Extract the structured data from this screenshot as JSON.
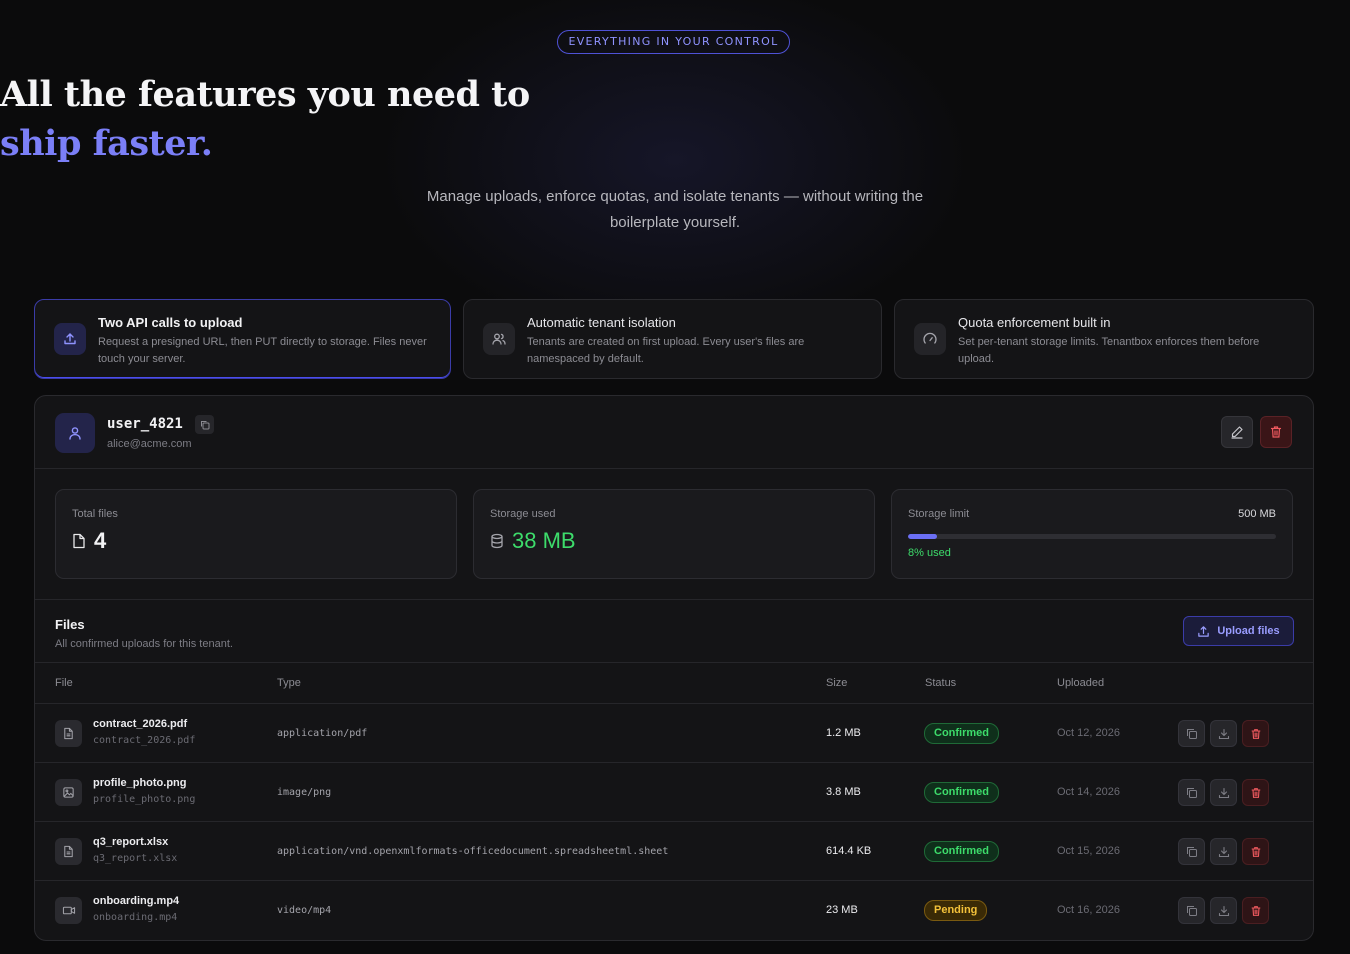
{
  "hero": {
    "eyebrow": "EVERYTHING IN YOUR CONTROL",
    "title_line1": "All the features you need to",
    "title_line2": "ship faster.",
    "subtitle": "Manage uploads, enforce quotas, and isolate tenants — without writing the boilerplate yourself."
  },
  "features": [
    {
      "title": "Two API calls to upload",
      "desc": "Request a presigned URL, then PUT directly to storage. Files never touch your server.",
      "icon": "upload-icon"
    },
    {
      "title": "Automatic tenant isolation",
      "desc": "Tenants are created on first upload. Every user's files are namespaced by default.",
      "icon": "users-icon"
    },
    {
      "title": "Quota enforcement built in",
      "desc": "Set per-tenant storage limits. Tenantbox enforces them before upload.",
      "icon": "gauge-icon"
    }
  ],
  "user": {
    "username": "user_4821",
    "email": "alice@acme.com"
  },
  "stats": {
    "total_files_label": "Total files",
    "total_files_value": "4",
    "storage_used_label": "Storage used",
    "storage_used_value": "38 MB",
    "storage_limit_label": "Storage limit",
    "storage_limit_value": "500 MB",
    "used_fraction": 0.08,
    "used_text": "8% used"
  },
  "files": {
    "title": "Files",
    "subtitle": "All confirmed uploads for this tenant.",
    "upload_label": "Upload files",
    "columns": {
      "file": "File",
      "type": "Type",
      "size": "Size",
      "status": "Status",
      "uploaded": "Uploaded"
    },
    "rows": [
      {
        "name": "contract_2026.pdf",
        "key": "contract_2026.pdf",
        "type": "application/pdf",
        "size": "1.2 MB",
        "status": "Confirmed",
        "date": "Oct 12, 2026",
        "icon": "document-icon"
      },
      {
        "name": "profile_photo.png",
        "key": "profile_photo.png",
        "type": "image/png",
        "size": "3.8 MB",
        "status": "Confirmed",
        "date": "Oct 14, 2026",
        "icon": "image-icon"
      },
      {
        "name": "q3_report.xlsx",
        "key": "q3_report.xlsx",
        "type": "application/vnd.openxmlformats-officedocument.spreadsheetml.sheet",
        "size": "614.4 KB",
        "status": "Confirmed",
        "date": "Oct 15, 2026",
        "icon": "document-icon"
      },
      {
        "name": "onboarding.mp4",
        "key": "onboarding.mp4",
        "type": "video/mp4",
        "size": "23 MB",
        "status": "Pending",
        "date": "Oct 16, 2026",
        "icon": "video-icon"
      }
    ]
  },
  "colors": {
    "accent": "#7b7ff7",
    "success": "#3ddc6b",
    "warning": "#f3c13a",
    "danger": "#e5484d",
    "background": "#0b0b0c"
  }
}
